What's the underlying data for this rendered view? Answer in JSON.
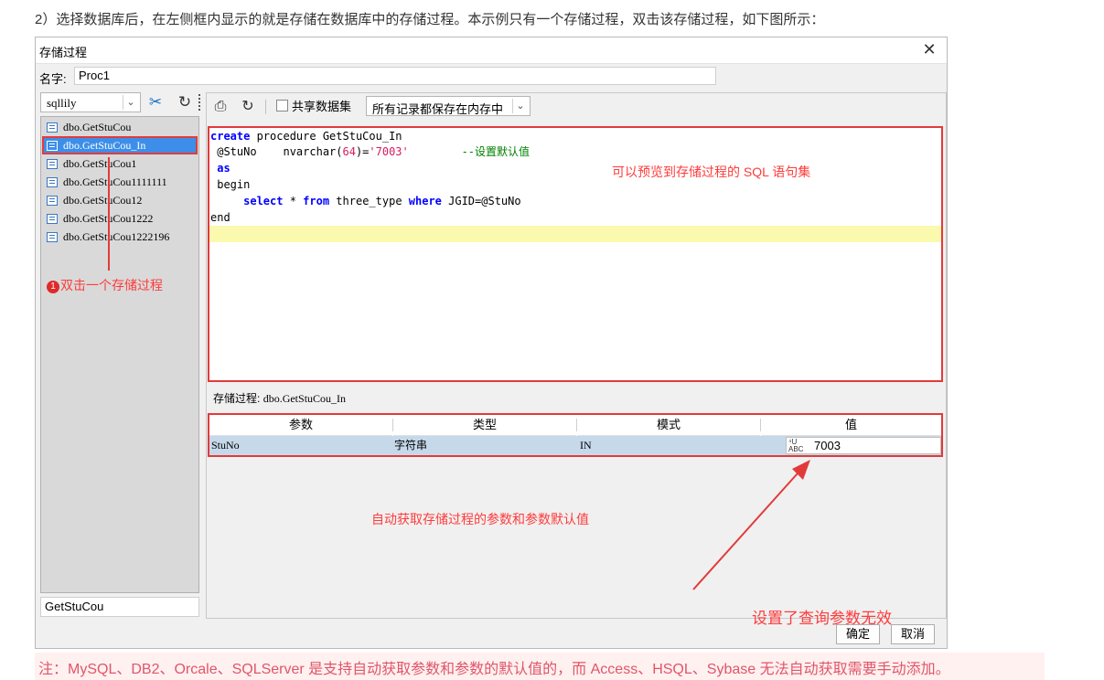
{
  "intro_text": "2）选择数据库后，在左侧框内显示的就是存储在数据库中的存储过程。本示例只有一个存储过程，双击该存储过程，如下图所示：",
  "dialog": {
    "title": "存储过程",
    "close_icon": "close-icon",
    "name_label": "名字:",
    "name_value": "Proc1"
  },
  "left": {
    "db_select": "sqllily",
    "tools": [
      "tools-icon",
      "refresh-icon"
    ],
    "procedures": [
      "dbo.GetStuCou",
      "dbo.GetStuCou_In",
      "dbo.GetStuCou1",
      "dbo.GetStuCou1111111",
      "dbo.GetStuCou12",
      "dbo.GetStuCou1222",
      "dbo.GetStuCou1222196"
    ],
    "selected_index": 1,
    "search_value": "GetStuCou"
  },
  "right": {
    "toolbar": {
      "preview_icon": "preview-icon",
      "refresh_icon": "refresh-icon",
      "share_label": "共享数据集",
      "mode_select": "所有记录都保存在内存中"
    },
    "code": {
      "l1_kw": "create",
      "l1_rest": " procedure GetStuCou_In",
      "l2_a": " @StuNo    nvarchar(",
      "l2_num": "64",
      "l2_b": ")=",
      "l2_str": "'7003'",
      "l2_gap": "        ",
      "l2_cmt": "--设置默认值",
      "l3_kw": " as",
      "l4": " begin",
      "l5_indent": "     ",
      "l5_kw1": "select",
      "l5_a": " * ",
      "l5_kw2": "from",
      "l5_b": " three_type ",
      "l5_kw3": "where",
      "l5_c": " JGID=@StuNo",
      "l6": "end"
    },
    "sp_label": "存储过程:",
    "sp_value": "dbo.GetStuCou_In",
    "table": {
      "headers": [
        "参数",
        "类型",
        "模式",
        "值"
      ],
      "row": {
        "param": "StuNo",
        "type": "字符串",
        "mode": "IN",
        "value_icon": "abc-type-icon",
        "value": "7003"
      }
    }
  },
  "buttons": {
    "ok": "确定",
    "cancel": "取消"
  },
  "annotations": {
    "preview_note": "可以预览到存储过程的 SQL 语句集",
    "step_badge": "1",
    "step_note": "双击一个存储过程",
    "auto_note": "自动获取存储过程的参数和参数默认值",
    "invalid_note": "设置了查询参数无效"
  },
  "note": "注：MySQL、DB2、Orcale、SQLServer 是支持自动获取参数和参数的默认值的，而 Access、HSQL、Sybase 无法自动获取需要手动添加。",
  "colors": {
    "annotation": "#e23a3a",
    "selection": "#3d8ee8",
    "keyword": "#0000ff",
    "string": "#d81b60",
    "comment": "#008000",
    "highlight": "#fbf9ae"
  }
}
